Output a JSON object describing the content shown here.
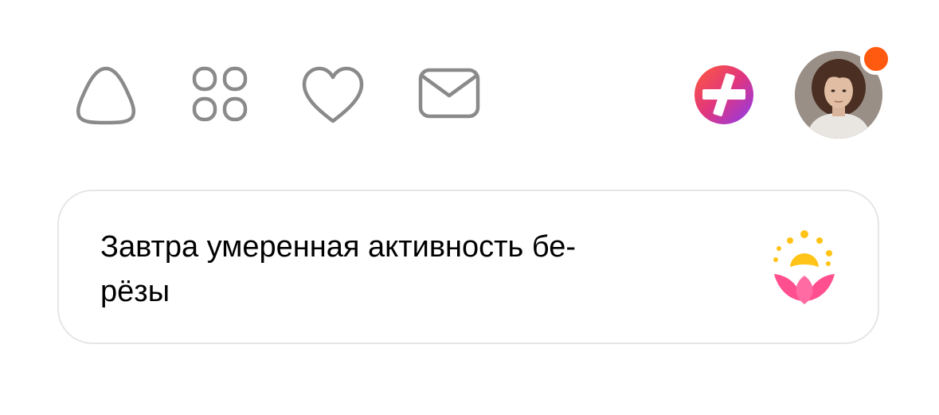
{
  "toolbar": {
    "items": [
      {
        "id": "alice",
        "icon": "alice-icon"
      },
      {
        "id": "services",
        "icon": "services-grid-icon"
      },
      {
        "id": "favorites",
        "icon": "heart-icon"
      },
      {
        "id": "mail",
        "icon": "mail-icon"
      },
      {
        "id": "plus",
        "icon": "yandex-plus-icon"
      }
    ],
    "icon_color": "#8a8a8a"
  },
  "profile": {
    "avatar": "user-avatar-photo",
    "has_notification": true,
    "notification_color": "#ff5a10"
  },
  "weather_card": {
    "text": "Завтра умеренная активность бе-\nрёзы",
    "icon": "pollen-flower-sun-icon",
    "border_color": "#e6e6e6"
  },
  "colors": {
    "plus_gradient": [
      "#ff5b3a",
      "#e0357f",
      "#8a3cf0"
    ],
    "pollen_sun": "#ffc417",
    "pollen_petal": "#ff4f8f"
  }
}
